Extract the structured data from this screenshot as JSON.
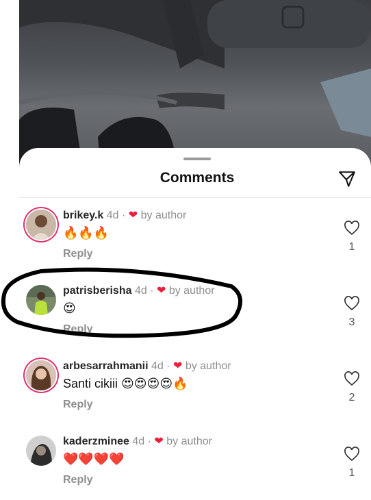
{
  "sheet": {
    "title": "Comments"
  },
  "comments": [
    {
      "username": "brikey.k",
      "time": "4d",
      "separator": "·",
      "liked_by": "by author",
      "text": "🔥🔥🔥",
      "reply": "Reply",
      "likes": "1"
    },
    {
      "username": "patrisberisha",
      "time": "4d",
      "separator": "·",
      "liked_by": "by author",
      "text": "😍",
      "reply": "Reply",
      "likes": "3"
    },
    {
      "username": "arbesarrahmanii",
      "time": "4d",
      "separator": "·",
      "liked_by": "by author",
      "text": "Santi cikiii 😍😍😍😍🔥",
      "reply": "Reply",
      "likes": "2"
    },
    {
      "username": "kaderzminee",
      "time": "4d",
      "separator": "·",
      "liked_by": "by author",
      "text": "❤️❤️❤️❤️",
      "reply": "Reply",
      "likes": "1"
    }
  ],
  "colors": {
    "accent_heart": "#ed1c3b",
    "story_ring": "#e1306c",
    "annotation": "#000000"
  }
}
